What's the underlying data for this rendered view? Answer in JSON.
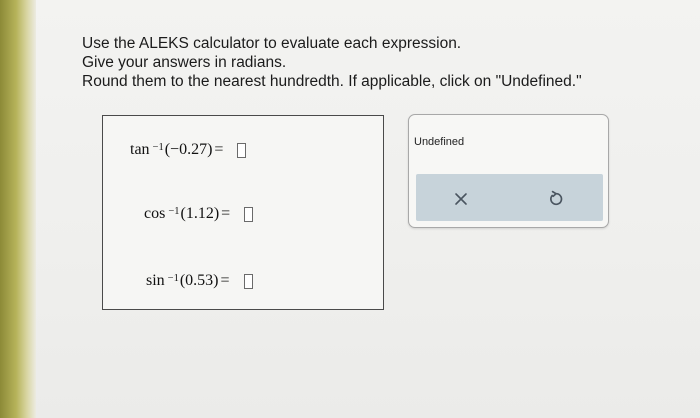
{
  "instructions": {
    "line1": "Use the ALEKS calculator to evaluate each expression.",
    "line2": "Give your answers in radians.",
    "line3": "Round them to the nearest hundredth. If applicable, click on \"Undefined.\""
  },
  "expressions": [
    {
      "fn": "tan",
      "exponent": "−1",
      "argument": "(−0.27)",
      "equals": "=",
      "answer": ""
    },
    {
      "fn": "cos",
      "exponent": "−1",
      "argument": "(1.12)",
      "equals": "=",
      "answer": ""
    },
    {
      "fn": "sin",
      "exponent": "−1",
      "argument": "(0.53)",
      "equals": "=",
      "answer": ""
    }
  ],
  "tools": {
    "undefined_label": "Undefined",
    "clear_icon": "x-icon",
    "undo_icon": "undo-icon",
    "action_bar_color": "#c7d3da"
  }
}
